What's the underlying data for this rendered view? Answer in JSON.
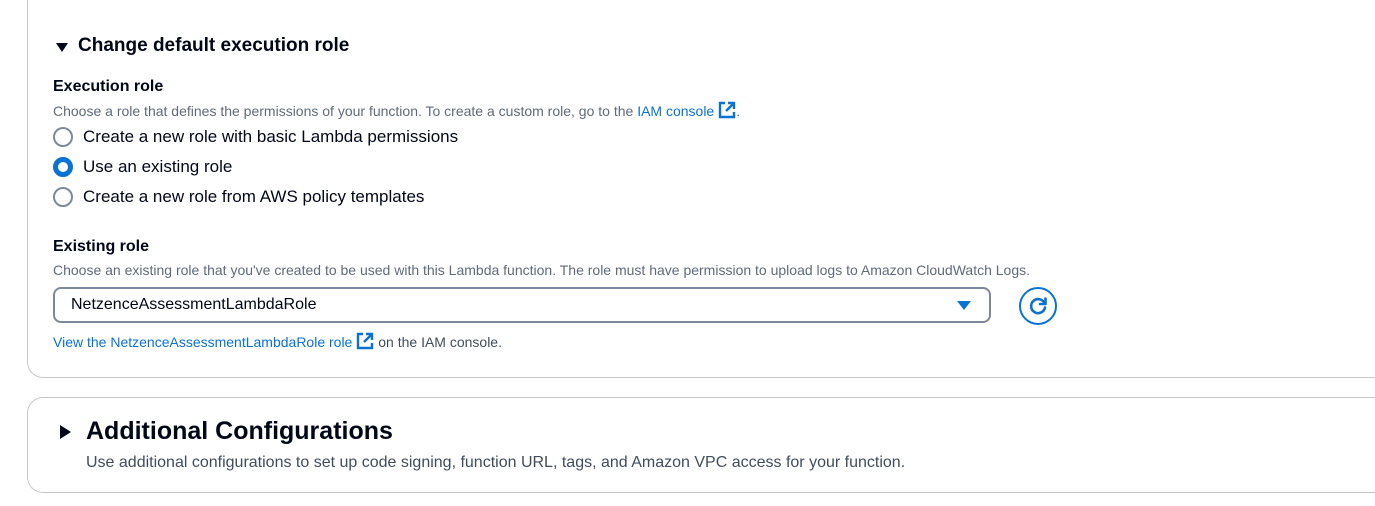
{
  "role_section": {
    "title": "Change default execution role",
    "execution_role": {
      "label": "Execution role",
      "description_prefix": "Choose a role that defines the permissions of your function. To create a custom role, go to the ",
      "iam_link": "IAM console",
      "description_suffix": ".",
      "options": [
        {
          "label": "Create a new role with basic Lambda permissions",
          "selected": false
        },
        {
          "label": "Use an existing role",
          "selected": true
        },
        {
          "label": "Create a new role from AWS policy templates",
          "selected": false
        }
      ]
    },
    "existing_role": {
      "label": "Existing role",
      "description": "Choose an existing role that you've created to be used with this Lambda function. The role must have permission to upload logs to Amazon CloudWatch Logs.",
      "selected_value": "NetzenceAssessmentLambdaRole",
      "view_link": "View the NetzenceAssessmentLambdaRole role",
      "view_suffix": " on the IAM console."
    }
  },
  "additional": {
    "title": "Additional Configurations",
    "description": "Use additional configurations to set up code signing, function URL, tags, and Amazon VPC access for your function."
  },
  "colors": {
    "accent": "#0972d3",
    "text": "#000716",
    "muted": "#5f6b7a",
    "border": "#c6c6cd"
  },
  "icons": [
    "caret-down-icon",
    "caret-right-icon",
    "external-link-icon",
    "dropdown-caret-icon",
    "refresh-icon"
  ]
}
